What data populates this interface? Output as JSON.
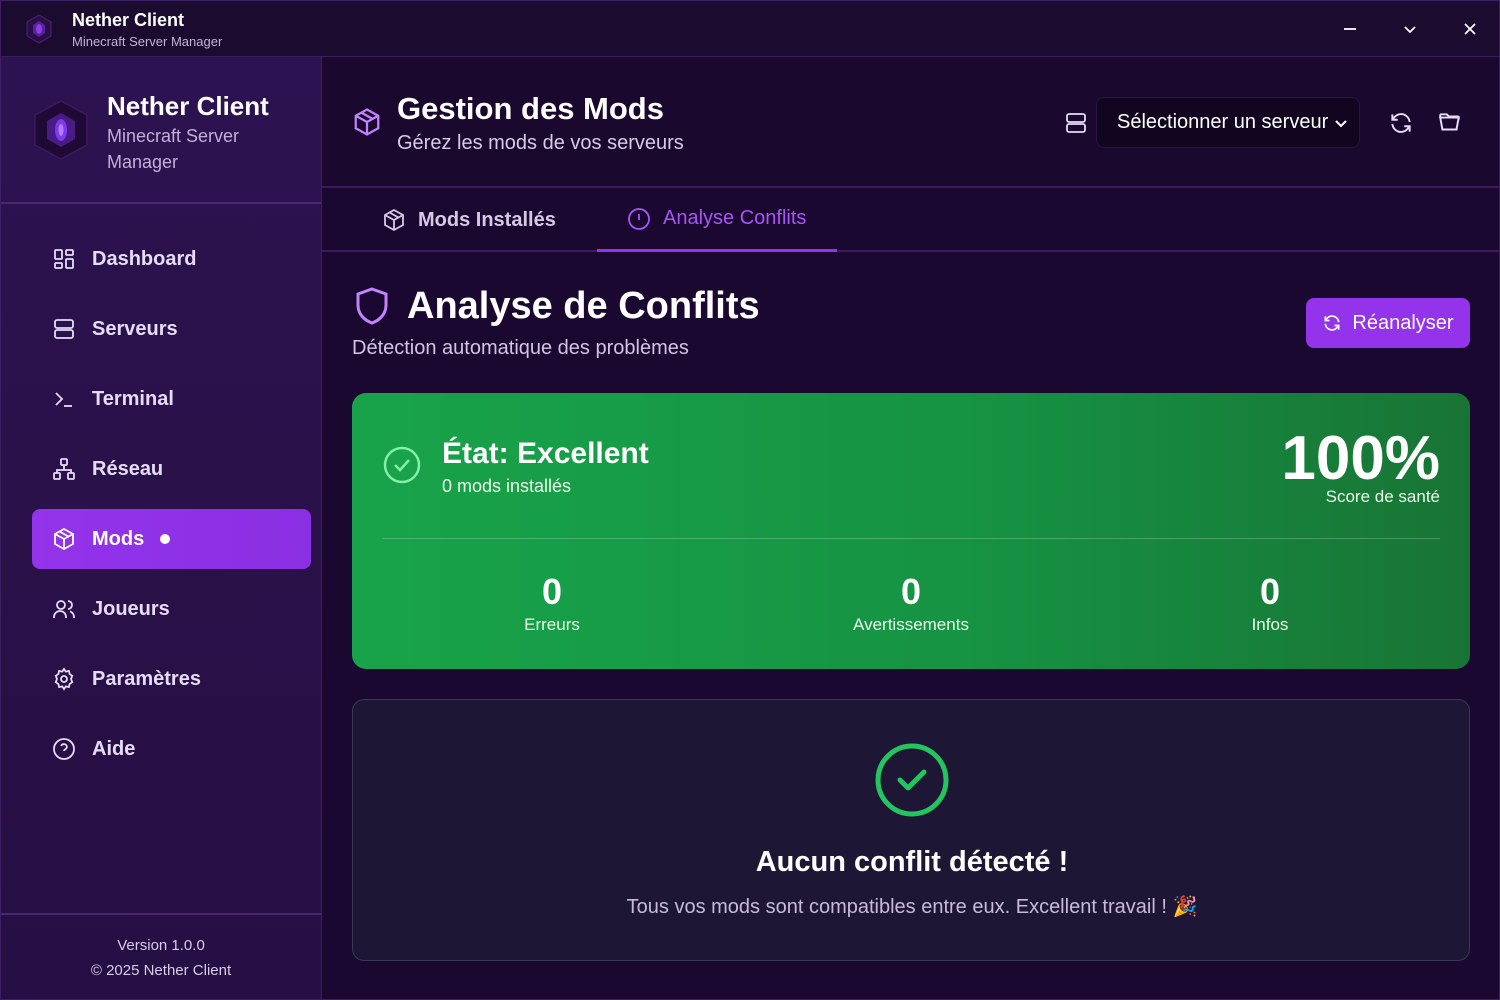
{
  "titlebar": {
    "title": "Nether Client",
    "subtitle": "Minecraft Server Manager"
  },
  "sidebar": {
    "brand_title": "Nether Client",
    "brand_subtitle": "Minecraft Server Manager",
    "items": [
      {
        "label": "Dashboard",
        "icon": "dashboard-icon"
      },
      {
        "label": "Serveurs",
        "icon": "server-icon"
      },
      {
        "label": "Terminal",
        "icon": "terminal-icon"
      },
      {
        "label": "Réseau",
        "icon": "network-icon"
      },
      {
        "label": "Mods",
        "icon": "package-icon",
        "active": true
      },
      {
        "label": "Joueurs",
        "icon": "users-icon"
      },
      {
        "label": "Paramètres",
        "icon": "gear-icon"
      },
      {
        "label": "Aide",
        "icon": "help-icon"
      }
    ],
    "version": "Version 1.0.0",
    "copyright": "© 2025 Nether Client"
  },
  "header": {
    "title": "Gestion des Mods",
    "subtitle": "Gérez les mods de vos serveurs",
    "server_select": "Sélectionner un serveur"
  },
  "tabs": [
    {
      "label": "Mods Installés"
    },
    {
      "label": "Analyse Conflits",
      "active": true
    }
  ],
  "analysis": {
    "title": "Analyse de Conflits",
    "subtitle": "Détection automatique des problèmes",
    "reanalyze_label": "Réanalyser",
    "state": "État: Excellent",
    "mods_count": "0 mods installés",
    "score": "100%",
    "score_label": "Score de santé",
    "stats": [
      {
        "value": "0",
        "label": "Erreurs"
      },
      {
        "value": "0",
        "label": "Avertissements"
      },
      {
        "value": "0",
        "label": "Infos"
      }
    ],
    "empty_title": "Aucun conflit détecté !",
    "empty_subtitle": "Tous vos mods sont compatibles entre eux. Excellent travail ! 🎉"
  },
  "colors": {
    "accent": "#9333ea",
    "success": "#18a34a",
    "background": "#1b0830"
  }
}
